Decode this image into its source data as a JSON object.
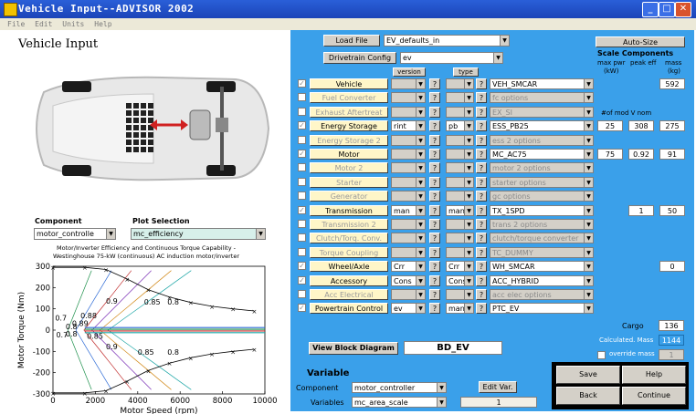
{
  "window": {
    "title": "Vehicle Input--ADVISOR 2002"
  },
  "menu": [
    "File",
    "Edit",
    "Units",
    "Help"
  ],
  "left": {
    "heading": "Vehicle Input",
    "component_label": "Component",
    "component_value": "motor_controlle",
    "plot_label": "Plot Selection",
    "plot_value": "mc_efficiency",
    "chart_title": "Motor/Inverter Efficiency and Continuous Torque Capability -\nWestinghouse 75-kW (continuous) AC induction motor/inverter"
  },
  "chart_data": {
    "type": "line",
    "title": "Motor/Inverter Efficiency and Continuous Torque Capability - Westinghouse 75-kW (continuous) AC induction motor/inverter",
    "xlabel": "Motor Speed (rpm)",
    "ylabel": "Motor Torque (Nm)",
    "xlim": [
      0,
      10000
    ],
    "ylim": [
      -300,
      300
    ],
    "xticks": [
      0,
      2000,
      4000,
      6000,
      8000,
      10000
    ],
    "yticks": [
      -300,
      -200,
      -100,
      0,
      100,
      200,
      300
    ],
    "series": [
      {
        "x": [
          0,
          1500,
          2500,
          3500,
          4500,
          5500,
          6500,
          7500,
          8500,
          9500
        ],
        "y": [
          295,
          295,
          285,
          240,
          190,
          155,
          130,
          112,
          100,
          90
        ]
      },
      {
        "x": [
          0,
          1500,
          2500,
          3500,
          4500,
          5500,
          6500,
          7500,
          8500,
          9500
        ],
        "y": [
          -295,
          -295,
          -285,
          -240,
          -190,
          -155,
          -130,
          -112,
          -100,
          -90
        ]
      }
    ],
    "contour_labels": [
      {
        "text": "0.9",
        "x": 2500,
        "y": 125
      },
      {
        "text": "0.85",
        "x": 4300,
        "y": 120
      },
      {
        "text": "0.8",
        "x": 5400,
        "y": 120
      },
      {
        "text": "0.88",
        "x": 1300,
        "y": 55
      },
      {
        "text": "0.7",
        "x": 100,
        "y": 45
      },
      {
        "text": "0.89",
        "x": 900,
        "y": 20
      },
      {
        "text": "0.8",
        "x": 600,
        "y": 5
      },
      {
        "text": "0.85",
        "x": 1600,
        "y": -40
      },
      {
        "text": "0.7",
        "x": 150,
        "y": -35
      },
      {
        "text": "0.8",
        "x": 600,
        "y": -30
      },
      {
        "text": "0.9",
        "x": 2500,
        "y": -90
      },
      {
        "text": "0.85",
        "x": 4000,
        "y": -115
      },
      {
        "text": "0.8",
        "x": 5400,
        "y": -115
      }
    ]
  },
  "top": {
    "load_file": "Load File",
    "file_value": "EV_defaults_in",
    "drivetrain_config": "Drivetrain Config",
    "drivetrain_value": "ev",
    "version": "version",
    "type": "type",
    "autosize": "Auto-Size",
    "scale_components": "Scale Components",
    "max_pwr": "max pwr",
    "max_pwr_unit": "(kW)",
    "peak_eff": "peak eff",
    "mass": "mass",
    "mass_unit": "(kg)",
    "num_mod": "#of mod V nom"
  },
  "rows": [
    {
      "checked": true,
      "name": "Vehicle",
      "ver": "",
      "typ": "",
      "comp": "VEH_SMCAR",
      "active": true,
      "vals": [
        "",
        "",
        "592"
      ]
    },
    {
      "checked": false,
      "name": "Fuel Converter",
      "ver": "",
      "typ": "",
      "comp": "fc options",
      "active": false,
      "vals": [
        "",
        "",
        ""
      ]
    },
    {
      "checked": false,
      "name": "Exhaust Aftertreat",
      "ver": "",
      "typ": "",
      "comp": "EX_SI",
      "active": false,
      "vals": [
        "",
        "",
        ""
      ]
    },
    {
      "checked": true,
      "name": "Energy Storage",
      "ver": "rint",
      "typ": "pb",
      "comp": "ESS_PB25",
      "active": true,
      "vals": [
        "25",
        "308",
        "275"
      ]
    },
    {
      "checked": false,
      "name": "Energy Storage 2",
      "ver": "",
      "typ": "",
      "comp": "ess 2 options",
      "active": false,
      "vals": [
        "",
        "",
        ""
      ]
    },
    {
      "checked": true,
      "name": "Motor",
      "ver": "",
      "typ": "",
      "comp": "MC_AC75",
      "active": true,
      "vals": [
        "75",
        "0.92",
        "91"
      ]
    },
    {
      "checked": false,
      "name": "Motor 2",
      "ver": "",
      "typ": "",
      "comp": "motor 2 options",
      "active": false,
      "vals": [
        "",
        "",
        ""
      ]
    },
    {
      "checked": false,
      "name": "Starter",
      "ver": "",
      "typ": "",
      "comp": "starter options",
      "active": false,
      "vals": [
        "",
        "",
        ""
      ]
    },
    {
      "checked": false,
      "name": "Generator",
      "ver": "",
      "typ": "",
      "comp": "gc options",
      "active": false,
      "vals": [
        "",
        "",
        ""
      ]
    },
    {
      "checked": true,
      "name": "Transmission",
      "ver": "man",
      "typ": "man",
      "comp": "TX_1SPD",
      "active": true,
      "vals": [
        "",
        "1",
        "50"
      ]
    },
    {
      "checked": false,
      "name": "Transmission 2",
      "ver": "",
      "typ": "",
      "comp": "trans 2 options",
      "active": false,
      "vals": [
        "",
        "",
        ""
      ]
    },
    {
      "checked": false,
      "name": "Clutch/Torq. Conv.",
      "ver": "",
      "typ": "",
      "comp": "clutch/torque converter",
      "active": false,
      "vals": [
        "",
        "",
        ""
      ]
    },
    {
      "checked": false,
      "name": "Torque Coupling",
      "ver": "",
      "typ": "",
      "comp": "TC_DUMMY",
      "active": false,
      "vals": [
        "",
        "",
        ""
      ]
    },
    {
      "checked": true,
      "name": "Wheel/Axle",
      "ver": "Crr",
      "typ": "Crr",
      "comp": "WH_SMCAR",
      "active": true,
      "vals": [
        "",
        "",
        "0"
      ]
    },
    {
      "checked": true,
      "name": "Accessory",
      "ver": "Cons",
      "typ": "Const",
      "comp": "ACC_HYBRID",
      "active": true,
      "vals": [
        "",
        "",
        ""
      ]
    },
    {
      "checked": false,
      "name": "Acc Electrical",
      "ver": "",
      "typ": "",
      "comp": "acc elec options",
      "active": false,
      "vals": [
        "",
        "",
        ""
      ]
    },
    {
      "checked": true,
      "name": "Powertrain Control",
      "ver": "ev",
      "typ": "man",
      "comp": "PTC_EV",
      "active": true,
      "vals": [
        "",
        "",
        ""
      ]
    }
  ],
  "bottom": {
    "cargo_label": "Cargo",
    "cargo_value": "136",
    "calc_mass_label": "Calculated. Mass",
    "calc_mass_value": "1144",
    "override_label": "override mass",
    "override_value": "1",
    "view_block": "View Block Diagram",
    "block_value": "BD_EV",
    "variable_heading": "Variable",
    "component_label": "Component",
    "component_value": "motor_controller",
    "variables_label": "Variables",
    "variables_value": "mc_area_scale",
    "edit_var": "Edit Var.",
    "var_value": "1",
    "save": "Save",
    "help": "Help",
    "back": "Back",
    "continue": "Continue"
  }
}
